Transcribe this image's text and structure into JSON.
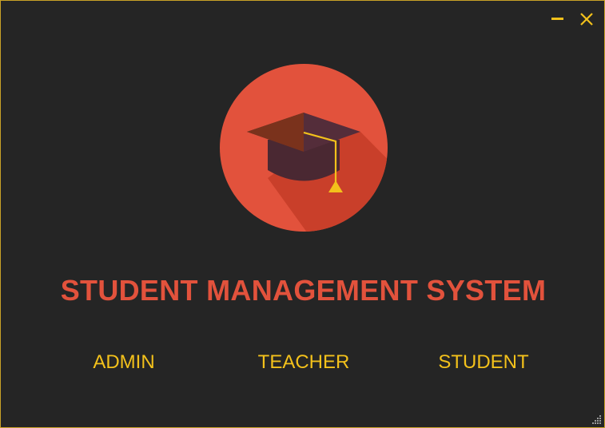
{
  "window": {
    "controls": {
      "minimize_icon": "minimize-icon",
      "close_icon": "close-icon"
    }
  },
  "logo": {
    "icon": "graduation-cap-icon",
    "colors": {
      "circle": "#e2523c",
      "cap": "#4a2832",
      "tassel": "#f3c11b"
    }
  },
  "title": "STUDENT MANAGEMENT SYSTEM",
  "roles": {
    "admin_label": "ADMIN",
    "teacher_label": "TEACHER",
    "student_label": "STUDENT"
  },
  "colors": {
    "background": "#252525",
    "accent": "#f3c11b",
    "title": "#e2523c",
    "border": "#c9a227"
  }
}
